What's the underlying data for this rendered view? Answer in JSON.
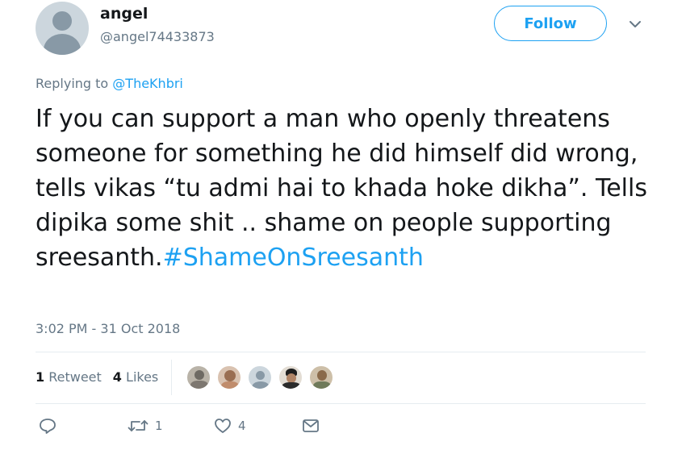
{
  "author": {
    "name": "angel",
    "handle": "@angel74433873"
  },
  "follow_label": "Follow",
  "reply": {
    "prefix": "Replying to ",
    "to": "@TheKhbri"
  },
  "tweet": {
    "text": "If you can support a man who openly threatens someone for something he did himself did wrong, tells vikas “tu admi hai to khada hoke dikha”. Tells dipika some shit .. shame on people supporting sreesanth.",
    "hashtag": "#ShameOnSreesanth"
  },
  "timestamp": "3:02 PM - 31 Oct 2018",
  "stats": {
    "retweets_count": "1",
    "retweets_label": "Retweet",
    "likes_count": "4",
    "likes_label": "Likes"
  },
  "likers": [
    {
      "name": "liker-1",
      "color": "#b9b3a8"
    },
    {
      "name": "liker-2",
      "color": "#c9a48a"
    },
    {
      "name": "liker-3",
      "color": "#ccd6dd"
    },
    {
      "name": "liker-4",
      "color": "#3a3a3a"
    },
    {
      "name": "liker-5",
      "color": "#a58c6c"
    }
  ],
  "actions": {
    "reply_icon": "reply-icon",
    "retweet_icon": "retweet-icon",
    "retweet_count": "1",
    "like_icon": "heart-icon",
    "like_count": "4",
    "dm_icon": "envelope-icon"
  },
  "colors": {
    "accent": "#1da1f2",
    "muted": "#657786",
    "text": "#14171a"
  }
}
